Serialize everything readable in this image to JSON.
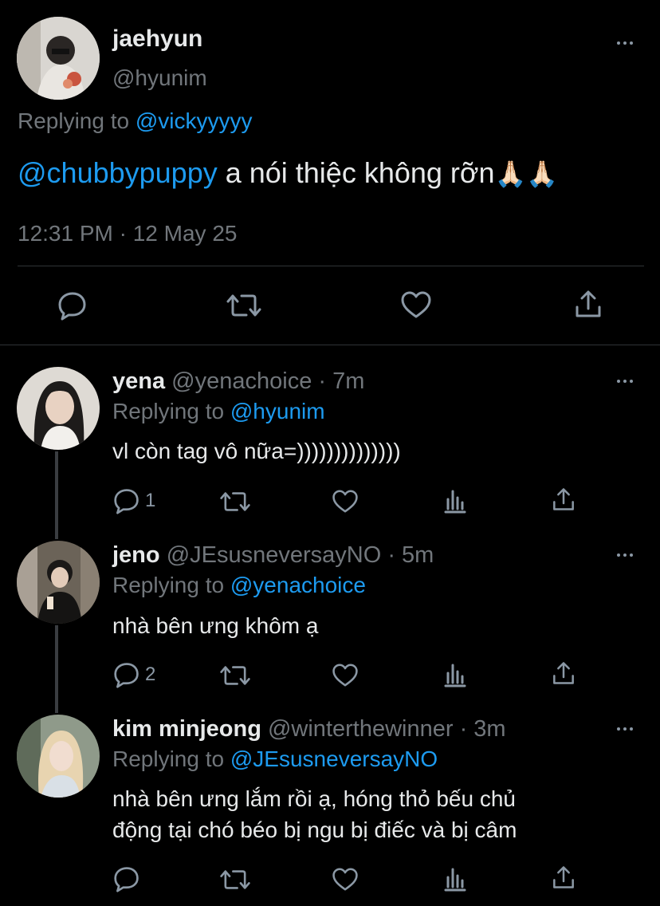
{
  "main_tweet": {
    "display_name": "jaehyun",
    "handle": "@hyunim",
    "replying_label": "Replying to",
    "replying_to": "@vickyyyyy",
    "mention": "@chubbypuppy",
    "text": " a nói thiệc không rỡn",
    "emoji": "🙏🏻🙏🏻",
    "timestamp": "12:31 PM · 12 May 25"
  },
  "replies": [
    {
      "display_name": "yena",
      "handle": "@yenachoice",
      "time": "· 7m",
      "replying_label": "Replying to",
      "replying_to": "@hyunim",
      "text": "vl còn tag vô nữa=))))))))))))))",
      "reply_count": "1"
    },
    {
      "display_name": "jeno",
      "handle": "@JEsusneversayNO",
      "time": "· 5m",
      "replying_label": "Replying to",
      "replying_to": "@yenachoice",
      "text": "nhà bên ưng khôm ạ",
      "reply_count": "2"
    },
    {
      "display_name": "kim minjeong",
      "handle": "@winterthewinner",
      "time": "· 3m",
      "replying_label": "Replying to",
      "replying_to": "@JEsusneversayNO",
      "text_line1": "nhà bên ưng lắm rồi ạ, hóng thỏ bếu chủ",
      "text_line2": "động tại chó béo bị ngu bị điếc và bị câm",
      "reply_count": ""
    }
  ],
  "icons": [
    "more-icon",
    "reply-icon",
    "retweet-icon",
    "like-icon",
    "share-icon",
    "analytics-icon"
  ],
  "colors": {
    "background": "#000000",
    "text": "#e7e9ea",
    "secondary": "#71767b",
    "accent": "#1d9bf0",
    "divider": "#2f3336"
  }
}
